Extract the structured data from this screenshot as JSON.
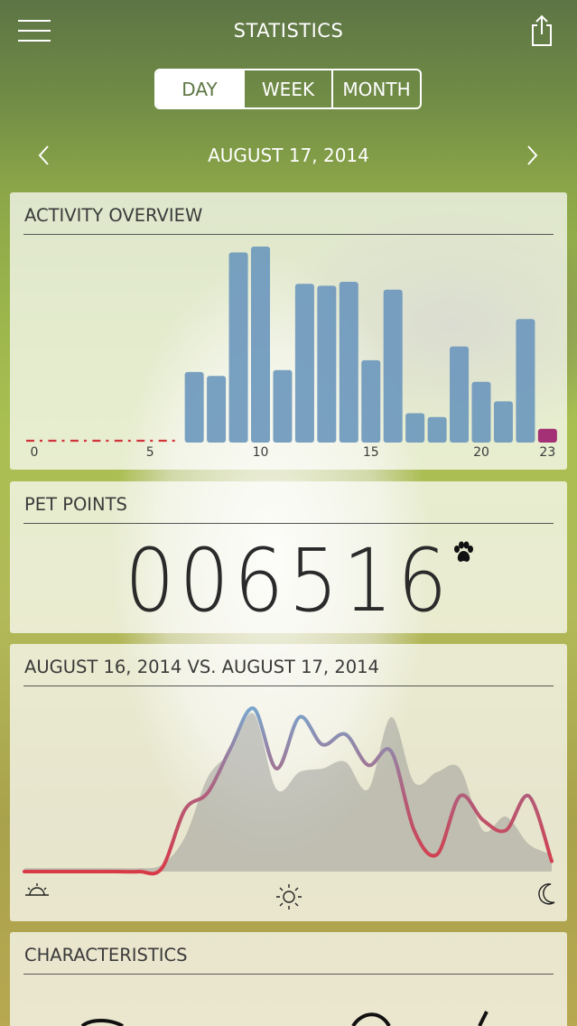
{
  "header": {
    "title": "STATISTICS",
    "menu_icon": "hamburger-menu-icon",
    "share_icon": "share-icon"
  },
  "range_tabs": [
    {
      "label": "DAY",
      "selected": true
    },
    {
      "label": "WEEK",
      "selected": false
    },
    {
      "label": "MONTH",
      "selected": false
    }
  ],
  "date_nav": {
    "date": "AUGUST 17, 2014",
    "prev_icon": "chevron-left-icon",
    "next_icon": "chevron-right-icon"
  },
  "activity": {
    "title": "ACTIVITY OVERVIEW"
  },
  "pet_points": {
    "title": "PET POINTS",
    "value": "006516",
    "icon": "paw-icon"
  },
  "comparison": {
    "title": "AUGUST 16, 2014 VS. AUGUST 17, 2014",
    "icons": [
      "sunrise-icon",
      "sun-icon",
      "moon-icon"
    ]
  },
  "characteristics": {
    "title": "CHARACTERISTICS"
  },
  "colors": {
    "bar": "#6e98bd",
    "bar_last": "#9e1f6e",
    "inactive_dash": "#d2343c",
    "line_start": "#d93a47",
    "line_end": "#7aa6cc"
  },
  "chart_data": [
    {
      "type": "bar",
      "categories": [
        0,
        1,
        2,
        3,
        4,
        5,
        6,
        7,
        8,
        9,
        10,
        11,
        12,
        13,
        14,
        15,
        16,
        17,
        18,
        19,
        20,
        21,
        22,
        23
      ],
      "tick_labels": [
        "0",
        "5",
        "10",
        "15",
        "20",
        "23"
      ],
      "tick_positions": [
        0,
        5,
        10,
        15,
        20,
        23
      ],
      "values": [
        0,
        0,
        0,
        0,
        0,
        0,
        0,
        36,
        34,
        97,
        100,
        37,
        81,
        80,
        82,
        42,
        78,
        15,
        13,
        49,
        31,
        21,
        63,
        7
      ],
      "ylim": [
        0,
        100
      ],
      "title": "ACTIVITY OVERVIEW",
      "grid": false
    },
    {
      "type": "area",
      "title": "AUGUST 16, 2014 VS. AUGUST 17, 2014",
      "x": [
        0,
        1,
        2,
        3,
        4,
        5,
        6,
        7,
        8,
        9,
        10,
        11,
        12,
        13,
        14,
        15,
        16,
        17,
        18,
        19,
        20,
        21,
        22,
        23
      ],
      "series": [
        {
          "values": [
            2,
            2,
            2,
            2,
            2,
            2,
            4,
            20,
            55,
            70,
            92,
            48,
            58,
            60,
            64,
            48,
            90,
            52,
            58,
            60,
            24,
            32,
            16,
            10
          ]
        },
        {
          "values": [
            0,
            0,
            0,
            0,
            0,
            0,
            2,
            36,
            46,
            72,
            95,
            60,
            90,
            74,
            80,
            62,
            70,
            24,
            10,
            44,
            30,
            24,
            44,
            6
          ]
        }
      ],
      "ylim": [
        0,
        100
      ],
      "grid": false
    }
  ]
}
